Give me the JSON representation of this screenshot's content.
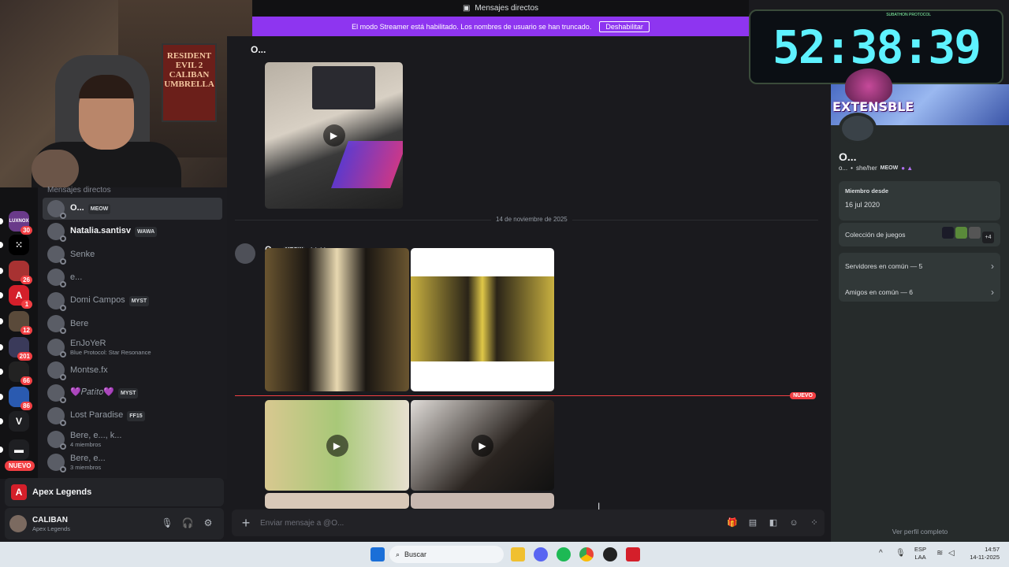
{
  "window": {
    "title": "Mensajes directos"
  },
  "streamer_banner": {
    "text": "El modo Streamer está habilitado. Los nombres de usuario se han truncado.",
    "button": "Deshabilitar"
  },
  "servers": [
    {
      "label": "LUXNOX",
      "badge": "30",
      "color": "#6a3a8a"
    },
    {
      "label": "⁙",
      "badge": "",
      "color": "#000000"
    },
    {
      "label": "",
      "badge": "26",
      "color": "#a83232"
    },
    {
      "label": "A",
      "badge": "1",
      "color": "#d41f2a"
    },
    {
      "label": "",
      "badge": "12",
      "color": "#5a4a3a"
    },
    {
      "label": "",
      "badge": "201",
      "color": "#3a3a5a"
    },
    {
      "label": "",
      "badge": "66",
      "color": "#222222"
    },
    {
      "label": "",
      "badge": "86",
      "color": "#2a5ab0"
    },
    {
      "label": "V",
      "badge": "",
      "color": "#1e1f22"
    },
    {
      "label": "▬",
      "badge": "",
      "color": "#1e1f22"
    }
  ],
  "nuevo_pill": "NUEVO",
  "dm_header": "Mensajes directos",
  "dms": [
    {
      "name": "O...",
      "tag": "MEOW",
      "sub": "",
      "active": true
    },
    {
      "name": "Natalia.santisv",
      "tag": "WAWA",
      "sub": "",
      "bright": true
    },
    {
      "name": "Senke",
      "tag": "",
      "sub": ""
    },
    {
      "name": "e...",
      "tag": "",
      "sub": ""
    },
    {
      "name": "Domi Campos",
      "tag": "MYST",
      "sub": ""
    },
    {
      "name": "Bere",
      "tag": "",
      "sub": ""
    },
    {
      "name": "EnJoYeR",
      "tag": "",
      "sub": "Blue Protocol: Star Resonance"
    },
    {
      "name": "Montse.fx",
      "tag": "",
      "sub": ""
    },
    {
      "name": "💜𝑃𝑎𝑡𝑖𝑡𝑜💜",
      "tag": "MYST",
      "sub": ""
    },
    {
      "name": "Lost Paradise",
      "tag": "FF15",
      "sub": ""
    },
    {
      "name": "Bere, e..., k...",
      "tag": "",
      "sub": "4 miembros"
    },
    {
      "name": "Bere, e...",
      "tag": "",
      "sub": "3 miembros"
    }
  ],
  "game_activity": {
    "title": "Apex Legends",
    "icon": "apex-icon"
  },
  "user": {
    "name": "CALIBAN",
    "status": "Apex Legends"
  },
  "chat": {
    "channel_title": "O...",
    "date_separator": "14 de noviembre de 2025",
    "new_label": "NUEVO",
    "author": "O...",
    "author_tag": "MEOW",
    "timestamp": "14:44",
    "composer_placeholder": "Enviar mensaje a @O..."
  },
  "webcam": {
    "poster_text": "RESIDENT EVIL 2 CALIBAN UMBRELLA"
  },
  "timer": {
    "value": "52:38:39",
    "label": "SUBATHON PROTOCOL"
  },
  "profile": {
    "overlay_text": "EXTENSBLE",
    "name": "O...",
    "handle": "o...",
    "pronouns": "she/her",
    "tag": "MEOW",
    "member_since_label": "Miembro desde",
    "member_since": "16 jul 2020",
    "games_label": "Colección de juegos",
    "games_more": "+4",
    "mutual_servers": "Servidores en común — 5",
    "mutual_friends": "Amigos en común — 6",
    "view_full": "Ver perfil completo"
  },
  "taskbar": {
    "search_placeholder": "Buscar",
    "lang_top": "ESP",
    "lang_bottom": "LAA",
    "time": "14:57",
    "date": "14-11-2025"
  }
}
